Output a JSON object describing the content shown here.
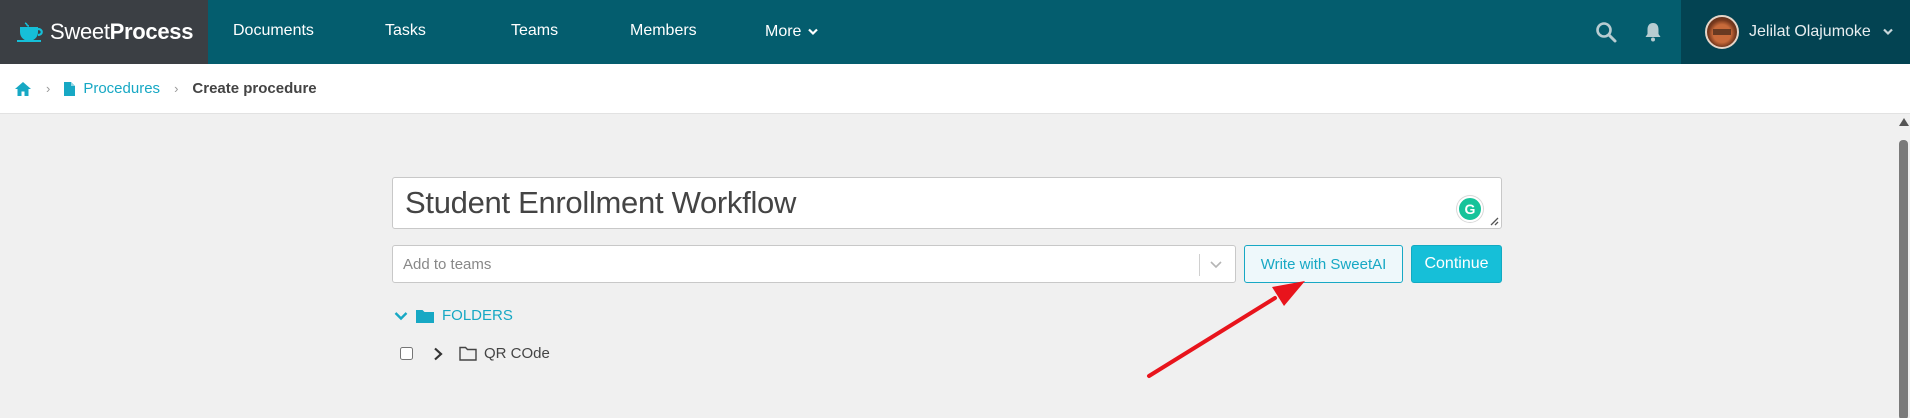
{
  "app": {
    "brand_light": "Sweet",
    "brand_bold": "Process"
  },
  "nav": {
    "items": [
      {
        "label": "Documents"
      },
      {
        "label": "Tasks"
      },
      {
        "label": "Teams"
      },
      {
        "label": "Members"
      },
      {
        "label": "More"
      }
    ],
    "icons": [
      "search-icon",
      "bell-icon"
    ],
    "user_name": "Jelilat Olajumoke"
  },
  "breadcrumb": {
    "home_icon": "home-icon",
    "procedures_label": "Procedures",
    "current_label": "Create procedure"
  },
  "form": {
    "title_value": "Student Enrollment Workflow",
    "teams_placeholder": "Add to teams",
    "ai_button_label": "Write with SweetAI",
    "continue_button_label": "Continue"
  },
  "folders": {
    "header_label": "FOLDERS",
    "items": [
      {
        "label": "QR COde",
        "checked": false
      }
    ]
  },
  "colors": {
    "navbar": "#045d6e",
    "brand_bg": "#3b3f44",
    "user_bg": "#034352",
    "accent": "#17a8c4",
    "continue_button": "#16bfd8",
    "annotation_arrow": "#e8141c"
  }
}
